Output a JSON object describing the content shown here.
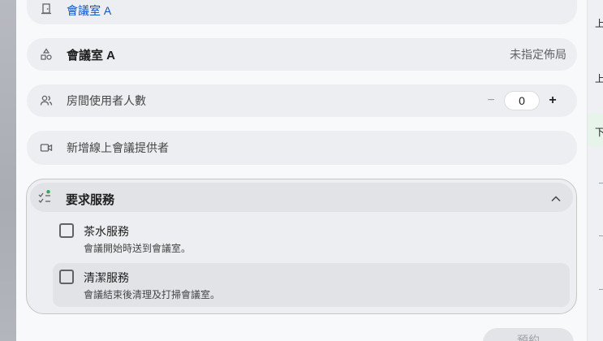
{
  "location": {
    "label": "會議室 A"
  },
  "room": {
    "name": "會議室 A",
    "layout": "未指定佈局"
  },
  "guests": {
    "label": "房間使用者人數",
    "minus": "−",
    "count": "0",
    "plus": "+"
  },
  "video": {
    "label": "新增線上會議提供者"
  },
  "services": {
    "title": "要求服務",
    "items": [
      {
        "name": "茶水服務",
        "description": "會議開始時送到會議室。"
      },
      {
        "name": "清潔服務",
        "description": "會議結束後清理及打掃會議室。"
      }
    ]
  },
  "actions": {
    "book": "預約"
  },
  "right_panel": {
    "labels": [
      "上",
      "上",
      "下"
    ]
  },
  "colors": {
    "accent_blue": "#0b57d0",
    "status_green": "#34a853"
  }
}
